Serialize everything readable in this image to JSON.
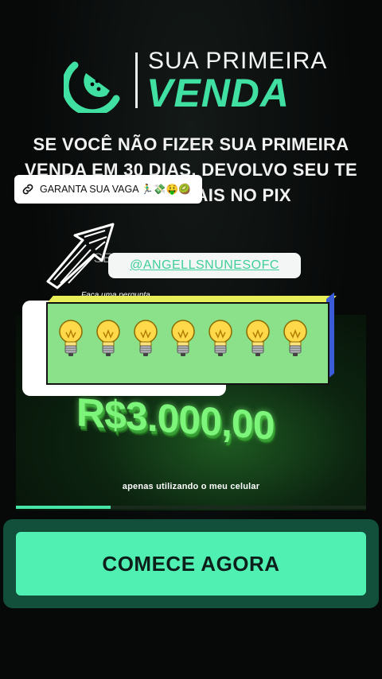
{
  "logo": {
    "line1": "SUA PRIMEIRA",
    "line2": "VENDA",
    "icon": "watermelon-slice-icon"
  },
  "headline": "SE VOCÊ NÃO FIZER SUA PRIMEIRA VENDA EM 30 DIAS, DEVOLVO SEU TE DOU 100 REAIS NO PIX",
  "subline": "SEM REAIS CELULAR E IPLES",
  "link_sticker": {
    "icon": "link-icon",
    "label": "GARANTA SUA VAGA 🏃‍♂️💸🤑🥝"
  },
  "mention_sticker": {
    "label": "@ANGELLSNUNESOFC"
  },
  "video": {
    "small_caption": "Faca uma pergunta",
    "bulb_count": 7,
    "money_text": "R$3.000,00",
    "subtitle": "apenas utilizando o meu celular",
    "progress": 0.27
  },
  "cta": {
    "label": "COMECE AGORA"
  },
  "colors": {
    "accent": "#3fe0a2",
    "cta": "#50f0b2",
    "background": "#070909"
  }
}
